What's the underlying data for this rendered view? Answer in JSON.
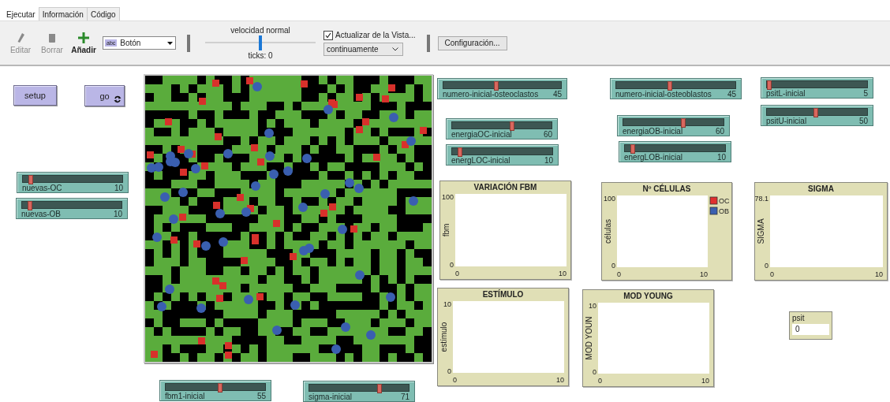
{
  "tabs": [
    {
      "label": "Ejecutar",
      "selected": true
    },
    {
      "label": "Información",
      "selected": false
    },
    {
      "label": "Código",
      "selected": false
    }
  ],
  "toolbar": {
    "tools": [
      {
        "kind": "edit",
        "label": "Editar",
        "disabled": true
      },
      {
        "kind": "delete",
        "label": "Borrar",
        "disabled": true
      },
      {
        "kind": "add",
        "label": "Añadir",
        "disabled": false
      }
    ],
    "widget_type": {
      "badge": "abc",
      "value": "Botón"
    },
    "speed": {
      "label": "velocidad normal",
      "level": 0.5,
      "ticks": "ticks: 0"
    },
    "view_updates": {
      "label": "Actualizar de la Vista...",
      "checked": true
    },
    "update_mode": "continuamente",
    "settings_button": "Configuración..."
  },
  "buttons": [
    {
      "label": "setup",
      "forever": false
    },
    {
      "label": "go",
      "forever": true
    }
  ],
  "sliders": [
    {
      "label": "numero-inicial-osteoclastos",
      "value": "45",
      "level": 0.45
    },
    {
      "label": "numero-inicial-osteoblastos",
      "value": "45",
      "level": 0.45
    },
    {
      "label": "psitL-inicial",
      "value": "5",
      "level": 0.02
    },
    {
      "label": "psitU-inicial",
      "value": "50",
      "level": 0.49
    },
    {
      "label": "energiaOC-inicial",
      "value": "60",
      "level": 0.6
    },
    {
      "label": "energiaOB-inicial",
      "value": "60",
      "level": 0.6
    },
    {
      "label": "energLOC-inicial",
      "value": "10",
      "level": 0.08
    },
    {
      "label": "energLOB-inicial",
      "value": "10",
      "level": 0.08
    },
    {
      "label": "nuevas-OC",
      "value": "10",
      "level": 0.08
    },
    {
      "label": "nuevas-OB",
      "value": "10",
      "level": 0.08
    },
    {
      "label": "fbm1-inicial",
      "value": "55",
      "level": 0.55
    },
    {
      "label": "sigma-inicial",
      "value": "71",
      "level": 0.71
    }
  ],
  "plots": [
    {
      "title": "VARIACIÓN FBM",
      "ylabel": "fbm",
      "y_tick_labels": [
        "100",
        "0"
      ],
      "x_tick_labels": [
        "0",
        "10"
      ]
    },
    {
      "title": "Nº CÉLULAS",
      "ylabel": "células",
      "y_tick_labels": [
        "100",
        "0"
      ],
      "x_tick_labels": [
        "0",
        "10"
      ],
      "legend": [
        {
          "name": "OC",
          "color": "#e03030"
        },
        {
          "name": "OB",
          "color": "#3a5fb0"
        }
      ]
    },
    {
      "title": "SIGMA",
      "ylabel": "SIGMA",
      "y_tick_labels": [
        "78.1",
        "0"
      ],
      "x_tick_labels": [
        "0",
        "10"
      ]
    },
    {
      "title": "ESTÍMULO",
      "ylabel": "estímulo",
      "y_tick_labels": [
        "10",
        "0"
      ],
      "x_tick_labels": [
        "0",
        "10"
      ]
    },
    {
      "title": "MOD YOUNG",
      "ylabel": "MOD YOUN",
      "y_tick_labels": [
        "10",
        "0"
      ],
      "x_tick_labels": [
        "0",
        "10"
      ]
    }
  ],
  "monitors": [
    {
      "label": "psit",
      "value": "0"
    }
  ]
}
